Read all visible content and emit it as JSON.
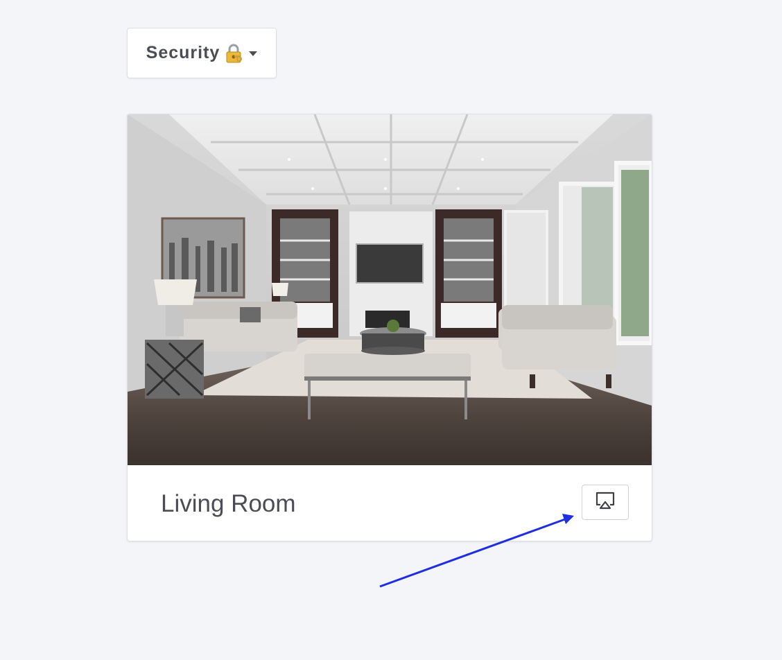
{
  "dropdown": {
    "label": "Security",
    "lock_icon": "locked-with-key-icon",
    "caret_icon": "caret-down-icon"
  },
  "card": {
    "image_alt": "Living room interior",
    "title": "Living Room",
    "cast_icon": "airplay-cast-icon"
  },
  "annotation": {
    "arrow_color": "#1f2fe0"
  },
  "colors": {
    "background": "#f4f5f9",
    "text": "#4a4d55",
    "border": "#dcdfe6"
  }
}
